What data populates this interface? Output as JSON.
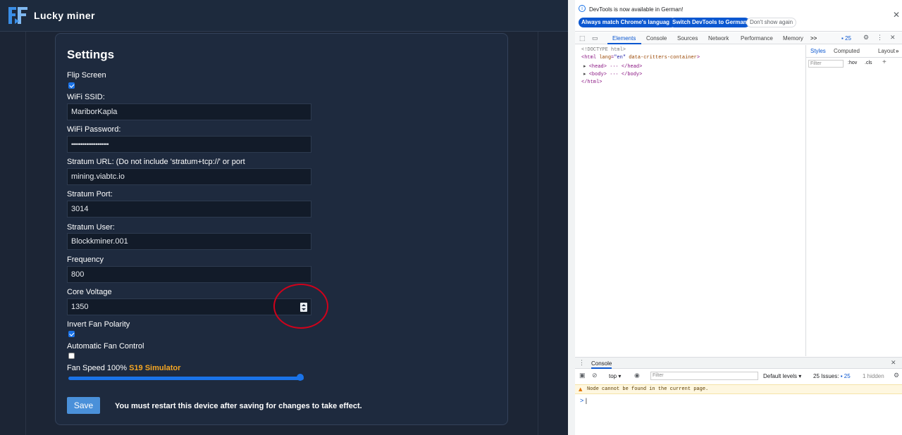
{
  "app": {
    "brand": "Lucky miner",
    "settings_title": "Settings",
    "fields": {
      "flip_screen_label": "Flip Screen",
      "wifi_ssid_label": "WiFi SSID:",
      "wifi_ssid_value": "MariborKapla",
      "wifi_password_label": "WiFi Password:",
      "wifi_password_value": "••••••••••••••••••••",
      "stratum_url_label": "Stratum URL: (Do not include 'stratum+tcp://' or port",
      "stratum_url_value": "mining.viabtc.io",
      "stratum_port_label": "Stratum Port:",
      "stratum_port_value": "3014",
      "stratum_user_label": "Stratum User:",
      "stratum_user_value": "Blockkminer.001",
      "frequency_label": "Frequency",
      "frequency_value": "800",
      "core_voltage_label": "Core Voltage",
      "core_voltage_value": "1350",
      "invert_fan_label": "Invert Fan Polarity",
      "auto_fan_label": "Automatic Fan Control",
      "fan_speed_label": "Fan Speed 100%",
      "fan_speed_value": 1.0,
      "simulator_label": "S19 Simulator"
    },
    "checkboxes": {
      "flip_screen": true,
      "invert_fan_polarity": true,
      "automatic_fan_control": false
    },
    "save_label": "Save",
    "restart_note": "You must restart this device after saving for changes to take effect.",
    "accent_color": "#f5a623",
    "annotation_color": "#d0021b"
  },
  "devtools": {
    "info": "DevTools is now available in German!",
    "btn_match": "Always match Chrome's language",
    "btn_switch": "Switch DevTools to German",
    "btn_dont_show": "Don't show again",
    "tabs": [
      "Elements",
      "Console",
      "Sources",
      "Network",
      "Performance",
      "Memory"
    ],
    "more_tabs": ">>",
    "issues_count": "25",
    "dom": {
      "doctype": "<!DOCTYPE html>",
      "html_open": "<html ",
      "html_attr": "lang",
      "html_attr_val": "\"en\"",
      "html_attr2": "data-critters-container",
      "html_close_bracket": ">",
      "head": "<head> ··· </head>",
      "body": "<body> ··· </body>",
      "html_end": "</html>"
    },
    "styles_tabs": [
      "Styles",
      "Computed",
      "Layout"
    ],
    "filter_placeholder": "Filter",
    "hov": ":hov",
    "cls": ".cls",
    "console_tab": "Console",
    "top_context": "top",
    "console_filter_placeholder": "Filter",
    "default_levels": "Default levels",
    "issues_label": "25 Issues:",
    "issues_badge": "25",
    "hidden_label": "1 hidden",
    "warning": "Node cannot be found in the current page.",
    "prompt": ">"
  }
}
